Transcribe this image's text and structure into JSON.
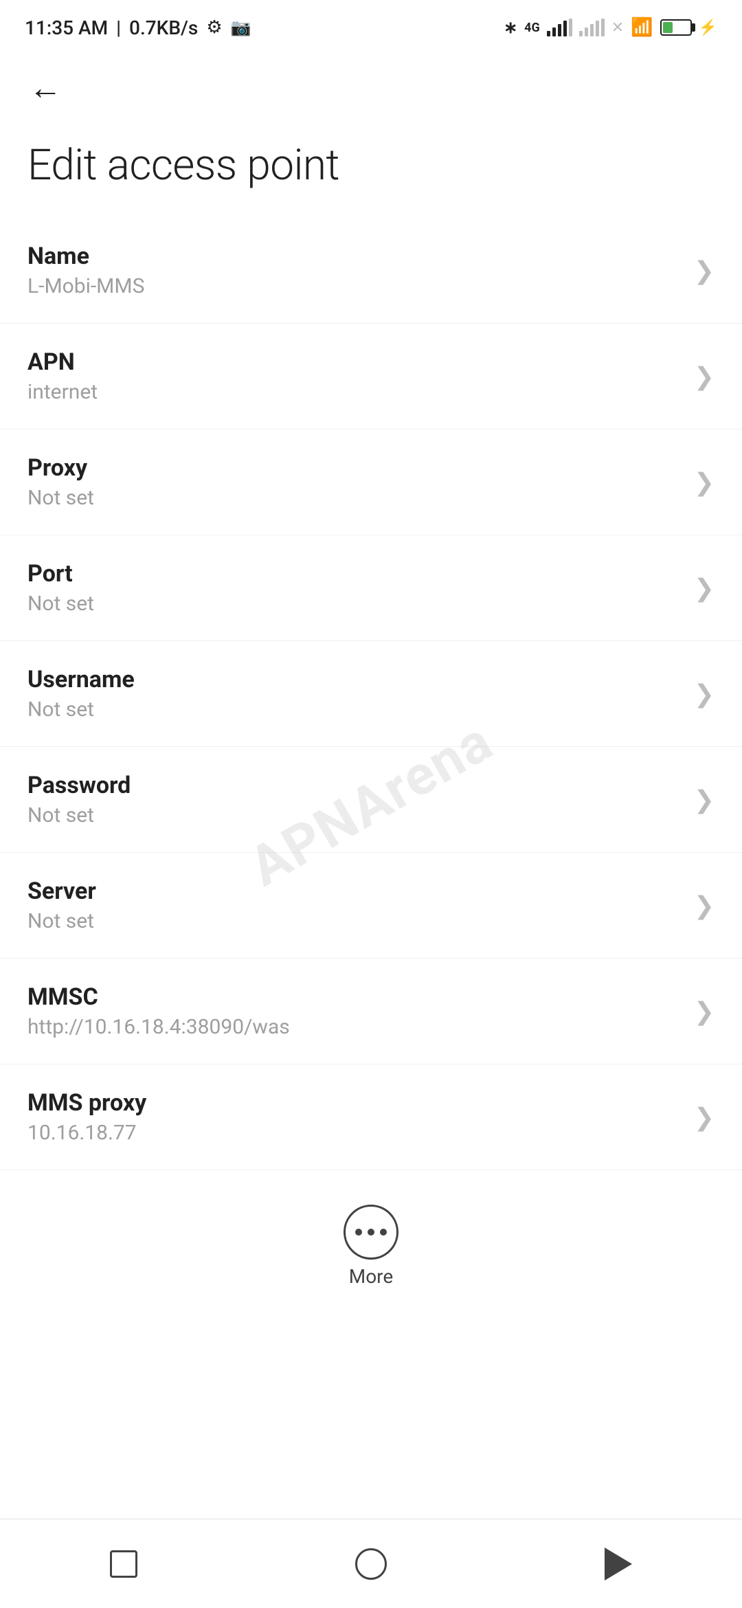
{
  "statusBar": {
    "time": "11:35 AM",
    "speed": "0.7KB/s"
  },
  "toolbar": {
    "backLabel": "←"
  },
  "page": {
    "title": "Edit access point"
  },
  "settings": [
    {
      "id": "name",
      "label": "Name",
      "value": "L-Mobi-MMS"
    },
    {
      "id": "apn",
      "label": "APN",
      "value": "internet"
    },
    {
      "id": "proxy",
      "label": "Proxy",
      "value": "Not set"
    },
    {
      "id": "port",
      "label": "Port",
      "value": "Not set"
    },
    {
      "id": "username",
      "label": "Username",
      "value": "Not set"
    },
    {
      "id": "password",
      "label": "Password",
      "value": "Not set"
    },
    {
      "id": "server",
      "label": "Server",
      "value": "Not set"
    },
    {
      "id": "mmsc",
      "label": "MMSC",
      "value": "http://10.16.18.4:38090/was"
    },
    {
      "id": "mms-proxy",
      "label": "MMS proxy",
      "value": "10.16.18.77"
    }
  ],
  "more": {
    "label": "More"
  },
  "bottomNav": {
    "squareLabel": "recent-apps",
    "circleLabel": "home",
    "triangleLabel": "back"
  },
  "watermark": {
    "text": "APNArena"
  }
}
